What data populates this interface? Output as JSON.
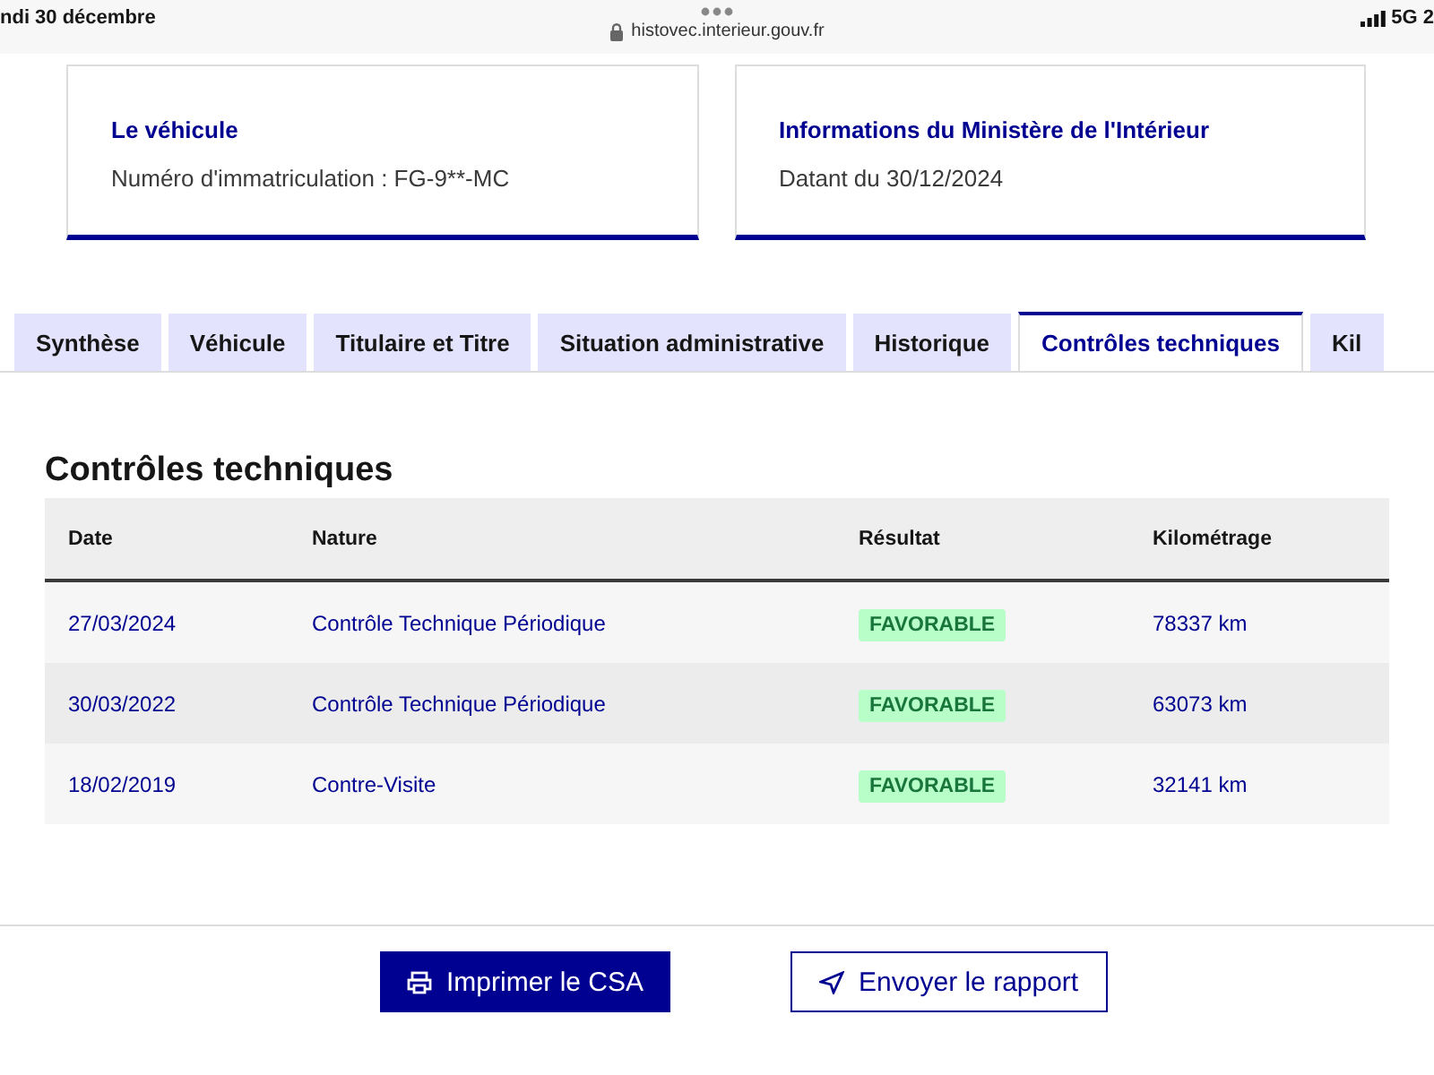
{
  "status_bar": {
    "date": "ndi 30 décembre",
    "url": "histovec.interieur.gouv.fr",
    "network": "5G 2"
  },
  "cards": [
    {
      "title": "Le véhicule",
      "text": "Numéro d'immatriculation : FG-9**-MC"
    },
    {
      "title": "Informations du Ministère de l'Intérieur",
      "text": "Datant du 30/12/2024"
    }
  ],
  "tabs": [
    {
      "label": "Synthèse",
      "selected": false
    },
    {
      "label": "Véhicule",
      "selected": false
    },
    {
      "label": "Titulaire et Titre",
      "selected": false
    },
    {
      "label": "Situation administrative",
      "selected": false
    },
    {
      "label": "Historique",
      "selected": false
    },
    {
      "label": "Contrôles techniques",
      "selected": true
    },
    {
      "label": "Kil",
      "selected": false
    }
  ],
  "section": {
    "title": "Contrôles techniques"
  },
  "table": {
    "columns": [
      "Date",
      "Nature",
      "Résultat",
      "Kilométrage"
    ],
    "rows": [
      [
        "27/03/2024",
        "Contrôle Technique Périodique",
        "FAVORABLE",
        "78337 km"
      ],
      [
        "30/03/2022",
        "Contrôle Technique Périodique",
        "FAVORABLE",
        "63073 km"
      ],
      [
        "18/02/2019",
        "Contre-Visite",
        "FAVORABLE",
        "32141 km"
      ]
    ]
  },
  "buttons": [
    {
      "label": "Imprimer le CSA",
      "kind": "primary"
    },
    {
      "label": "Envoyer le rapport",
      "kind": "secondary"
    }
  ]
}
